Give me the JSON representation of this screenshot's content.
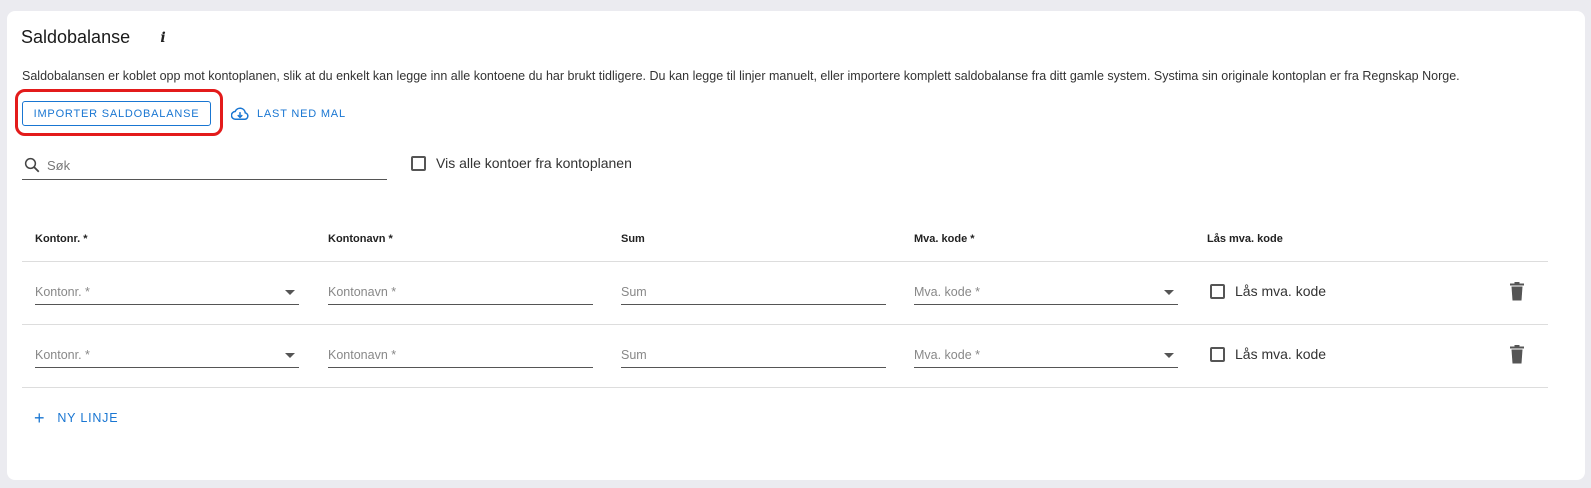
{
  "header": {
    "title": "Saldobalanse",
    "info_glyph": "i"
  },
  "description": "Saldobalansen er koblet opp mot kontoplanen, slik at du enkelt kan legge inn alle kontoene du har brukt tidligere. Du kan legge til linjer manuelt, eller importere komplett saldobalanse fra ditt gamle system. Systima sin originale kontoplan er fra Regnskap Norge.",
  "actions": {
    "import_label": "IMPORTER SALDOBALANSE",
    "download_label": "LAST NED MAL"
  },
  "search": {
    "placeholder": "Søk"
  },
  "show_all": {
    "label": "Vis alle kontoer fra kontoplanen",
    "checked": false
  },
  "table": {
    "headers": [
      "Kontonr. *",
      "Kontonavn *",
      "Sum",
      "Mva. kode *",
      "Lås mva. kode"
    ],
    "rows": [
      {
        "account_placeholder": "Kontonr. *",
        "name_placeholder": "Kontonavn *",
        "sum_placeholder": "Sum",
        "vat_placeholder": "Mva. kode *",
        "lock_label": "Lås mva. kode"
      },
      {
        "account_placeholder": "Kontonr. *",
        "name_placeholder": "Kontonavn *",
        "sum_placeholder": "Sum",
        "vat_placeholder": "Mva. kode *",
        "lock_label": "Lås mva. kode"
      }
    ]
  },
  "add_line": {
    "plus": "+",
    "label": "NY LINJE"
  },
  "icons": {
    "info": "info-icon",
    "download": "cloud-download-icon",
    "search": "search-icon",
    "dropdown": "chevron-down-icon",
    "delete": "trash-icon",
    "add": "plus-icon"
  },
  "colors": {
    "accent": "#1976d2",
    "highlight": "#e31b1b",
    "background": "#ebebf0"
  }
}
